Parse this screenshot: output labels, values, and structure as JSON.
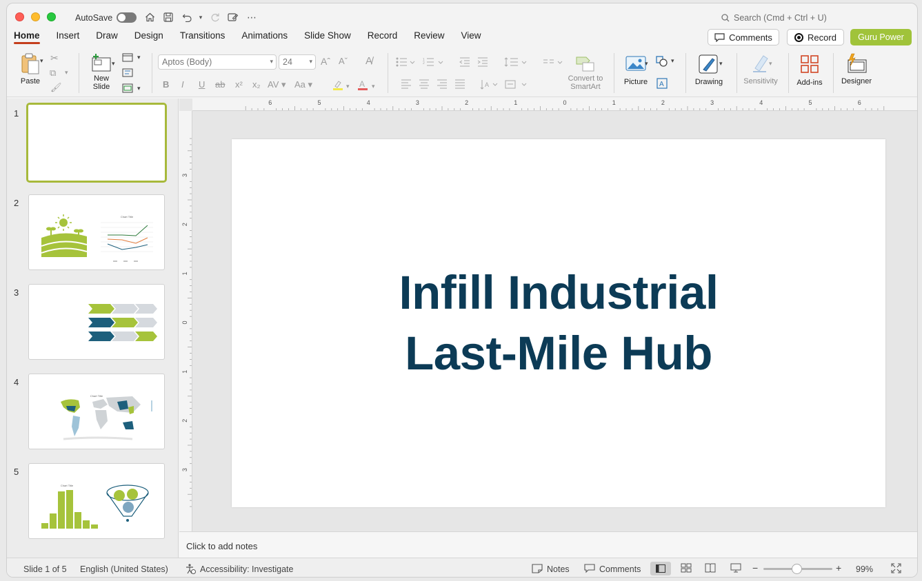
{
  "titlebar": {
    "autosave_label": "AutoSave",
    "search_placeholder": "Search (Cmd + Ctrl + U)"
  },
  "ribbon_tabs": [
    "Home",
    "Insert",
    "Draw",
    "Design",
    "Transitions",
    "Animations",
    "Slide Show",
    "Record",
    "Review",
    "View"
  ],
  "actions": {
    "comments": "Comments",
    "record": "Record",
    "guru": "Guru Power",
    "guru_color": "#a0c33a"
  },
  "ribbon": {
    "paste": "Paste",
    "new_slide_line1": "New",
    "new_slide_line2": "Slide",
    "font_name": "Aptos (Body)",
    "font_size": "24",
    "convert_line1": "Convert to",
    "convert_line2": "SmartArt",
    "picture": "Picture",
    "drawing": "Drawing",
    "sensitivity": "Sensitivity",
    "addins": "Add-ins",
    "designer": "Designer"
  },
  "ruler": {
    "top_ticks": [
      "6",
      "5",
      "4",
      "3",
      "2",
      "1",
      "0",
      "1",
      "2",
      "3",
      "4",
      "5",
      "6"
    ],
    "left_ticks": [
      "3",
      "2",
      "1",
      "0",
      "1",
      "2",
      "3"
    ]
  },
  "thumbnails": [
    {
      "num": "1"
    },
    {
      "num": "2",
      "chart_title": "Chart Title"
    },
    {
      "num": "3"
    },
    {
      "num": "4",
      "chart_title": "Chart Title"
    },
    {
      "num": "5",
      "chart_title": "Chart Title"
    }
  ],
  "slide": {
    "title_line1": "Infill Industrial",
    "title_line2": "Last-Mile Hub",
    "title_color": "#0c3b56"
  },
  "notes_placeholder": "Click to add notes",
  "status": {
    "slide_count": "Slide 1 of 5",
    "language": "English (United States)",
    "accessibility": "Accessibility: Investigate",
    "notes": "Notes",
    "comments": "Comments",
    "zoom": "99%"
  }
}
